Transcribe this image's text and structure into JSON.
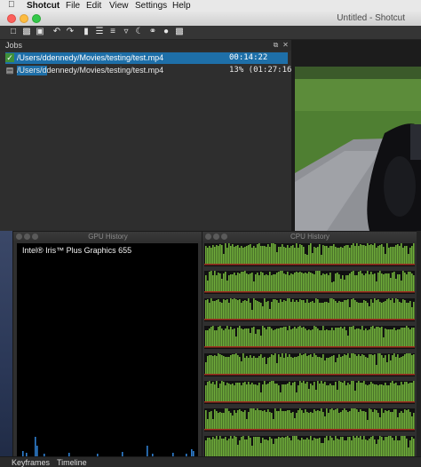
{
  "menubar": {
    "app_name": "Shotcut",
    "items": [
      "File",
      "Edit",
      "View",
      "Settings",
      "Help"
    ]
  },
  "window": {
    "title": "Untitled - Shotcut"
  },
  "toolbar": {
    "icons": [
      "open-file-icon",
      "open-other-icon",
      "save-icon",
      "undo-icon",
      "redo-icon",
      "peak-meter-icon",
      "properties-icon",
      "playlist-icon",
      "filters-icon",
      "history-icon",
      "keyframes-icon",
      "jobs-icon",
      "export-icon"
    ]
  },
  "jobs": {
    "title": "Jobs",
    "rows": [
      {
        "name": "/Users/ddennedy/Movies/testing/test.mp4",
        "status": "00:14:22",
        "icon": "check-icon",
        "selected": true
      },
      {
        "name": "/Users/ddennedy/Movies/testing/test.mp4",
        "status": "13% (01:27:16)",
        "icon": "running-icon",
        "selected": false
      }
    ]
  },
  "gpu_window": {
    "title": "GPU History",
    "device": "Intel® Iris™ Plus Graphics 655"
  },
  "cpu_window": {
    "title": "CPU History",
    "cores": 8
  },
  "tabs": [
    "Keyframes",
    "Timeline"
  ],
  "colors": {
    "cpu_bar": "#6fae3a",
    "cpu_line": "#a03020",
    "gpu_bar": "#2f7fd0",
    "selection": "#1e6fa8"
  }
}
